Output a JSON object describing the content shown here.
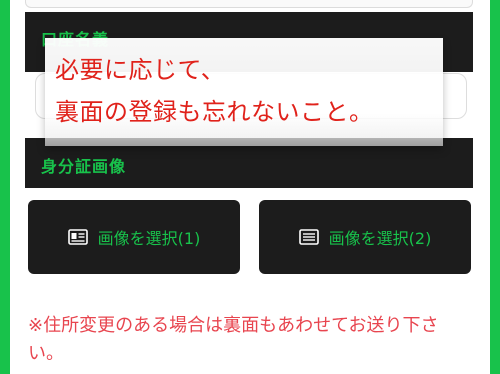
{
  "colors": {
    "accent_green": "#18c24b",
    "dark_panel": "#1c1c1c",
    "overlay_text": "#e0221b",
    "notice_text": "#e8454f"
  },
  "sections": {
    "account_holder_title": "口座名義",
    "id_images_title": "身分証画像"
  },
  "overlay": {
    "line1": "必要に応じて、",
    "line2": "裏面の登録も忘れないこと。"
  },
  "buttons": [
    {
      "label": "画像を選択(1)",
      "icon": "id-card-icon"
    },
    {
      "label": "画像を選択(2)",
      "icon": "document-icon"
    }
  ],
  "notice": "※住所変更のある場合は裏面もあわせてお送り下さい。"
}
